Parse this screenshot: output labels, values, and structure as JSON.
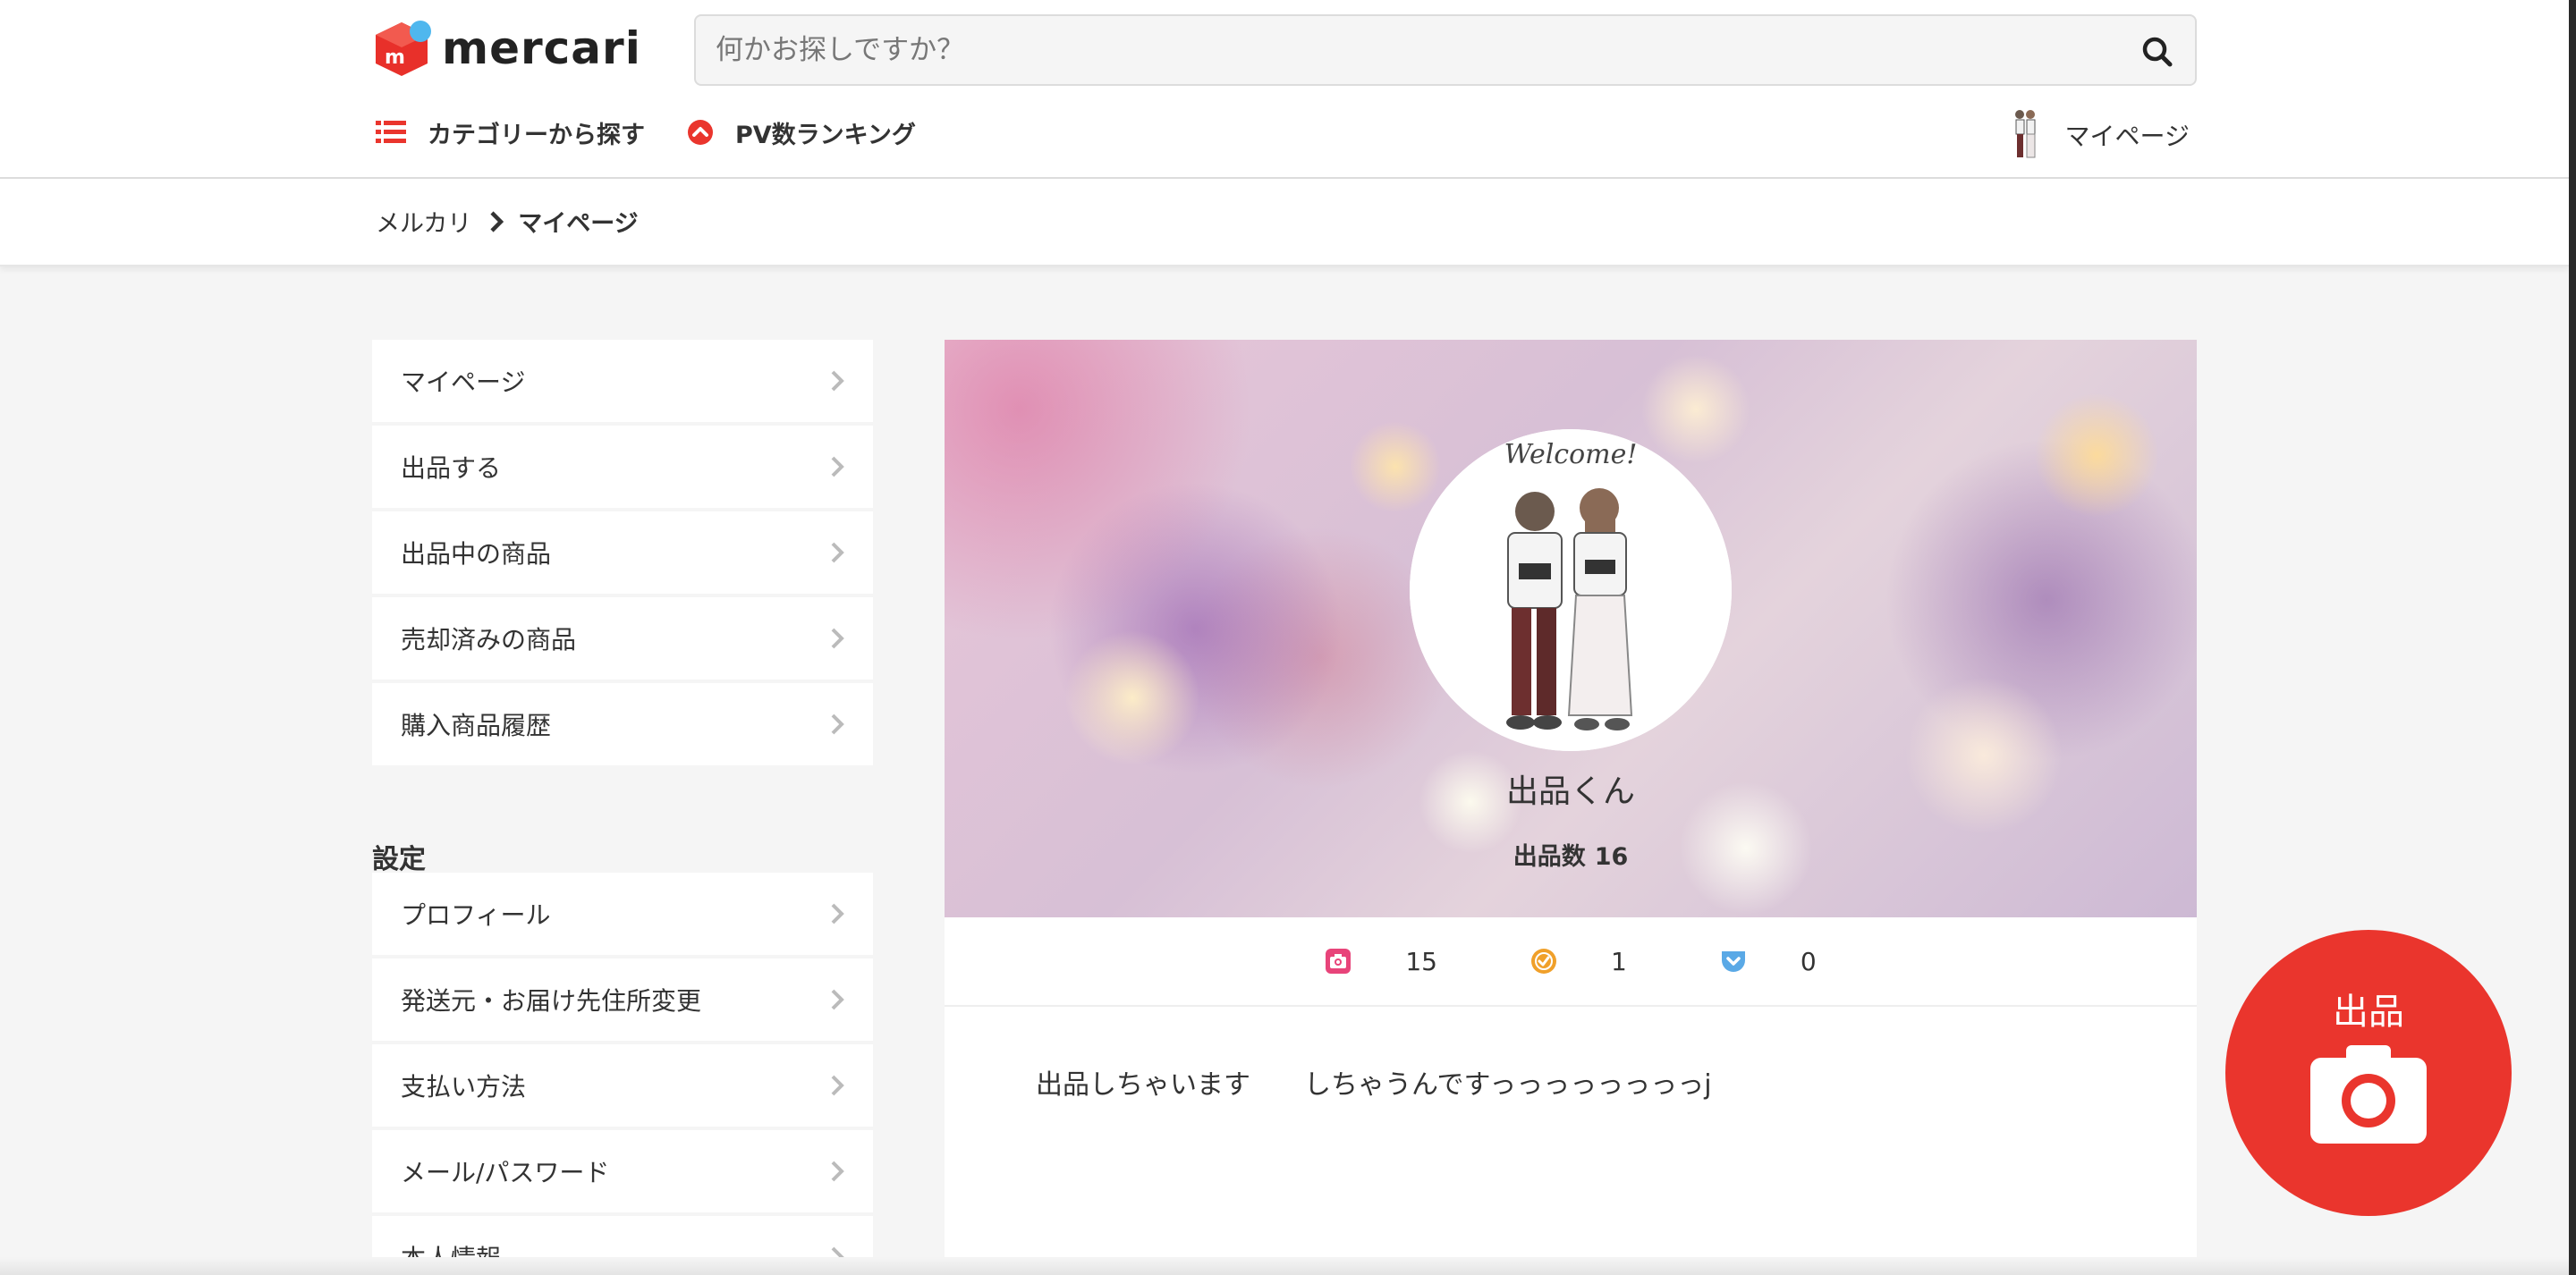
{
  "header": {
    "logo_text": "mercari",
    "search_placeholder": "何かお探しですか？",
    "nav": {
      "category": "カテゴリーから探す",
      "ranking": "PV数ランキング",
      "mypage": "マイページ"
    }
  },
  "breadcrumb": {
    "home": "メルカリ",
    "current": "マイページ"
  },
  "sidebar": {
    "items": [
      {
        "label": "マイページ"
      },
      {
        "label": "出品する"
      },
      {
        "label": "出品中の商品"
      },
      {
        "label": "売却済みの商品"
      },
      {
        "label": "購入商品履歴"
      }
    ],
    "settings_heading": "設定",
    "settings_items": [
      {
        "label": "プロフィール"
      },
      {
        "label": "発送元・お届け先住所変更"
      },
      {
        "label": "支払い方法"
      },
      {
        "label": "メール/パスワード"
      },
      {
        "label": "本人情報"
      }
    ]
  },
  "profile": {
    "avatar_caption": "Welcome!",
    "name": "出品くん",
    "listing_label": "出品数",
    "listing_count": "16",
    "stats": [
      {
        "icon": "camera-badge-icon",
        "color": "#e8447a",
        "value": "15"
      },
      {
        "icon": "check-badge-icon",
        "color": "#f0a02a",
        "value": "1"
      },
      {
        "icon": "pocket-badge-icon",
        "color": "#5aa9e6",
        "value": "0"
      }
    ],
    "bio": "出品しちゃいます　　しちゃうんですっっっっっっっっj"
  },
  "sell_button": {
    "label": "出品"
  },
  "colors": {
    "brand_red": "#ea352d",
    "text": "#333333",
    "background": "#f5f5f5"
  }
}
